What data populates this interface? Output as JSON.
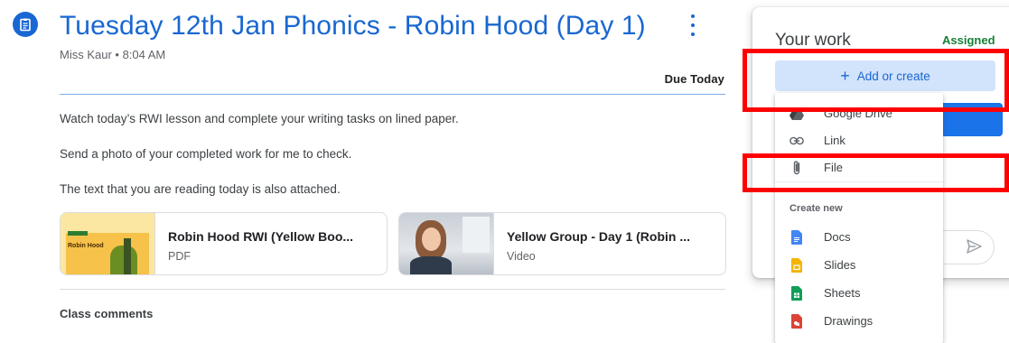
{
  "assignment": {
    "title": "Tuesday 12th Jan Phonics - Robin Hood (Day 1)",
    "meta": "Miss Kaur • 8:04 AM",
    "due": "Due Today",
    "instructions": [
      "Watch today’s RWI lesson and complete your writing tasks on lined paper.",
      "Send a photo of your completed work for me to check.",
      "The text that you are reading today is also attached."
    ],
    "attachments": [
      {
        "title": "Robin Hood RWI (Yellow Boo...",
        "type": "PDF",
        "thumb_title": "Robin Hood"
      },
      {
        "title": "Yellow Group - Day 1 (Robin ...",
        "type": "Video"
      }
    ],
    "class_comments": "Class comments"
  },
  "your_work": {
    "heading": "Your work",
    "status": "Assigned",
    "add_label": "Add or create",
    "add_plus": "+"
  },
  "menu": {
    "items": [
      {
        "label": "Google Drive",
        "icon": "drive-icon"
      },
      {
        "label": "Link",
        "icon": "link-icon"
      },
      {
        "label": "File",
        "icon": "paperclip-icon"
      }
    ],
    "create_new_label": "Create new",
    "create_items": [
      {
        "label": "Docs",
        "icon": "docs-icon",
        "color": "#4285f4"
      },
      {
        "label": "Slides",
        "icon": "slides-icon",
        "color": "#f4b400"
      },
      {
        "label": "Sheets",
        "icon": "sheets-icon",
        "color": "#0f9d58"
      },
      {
        "label": "Drawings",
        "icon": "drawings-icon",
        "color": "#db4437"
      }
    ]
  },
  "colors": {
    "accent": "#1967d2",
    "assigned": "#188038",
    "highlight": "#ff0000"
  }
}
